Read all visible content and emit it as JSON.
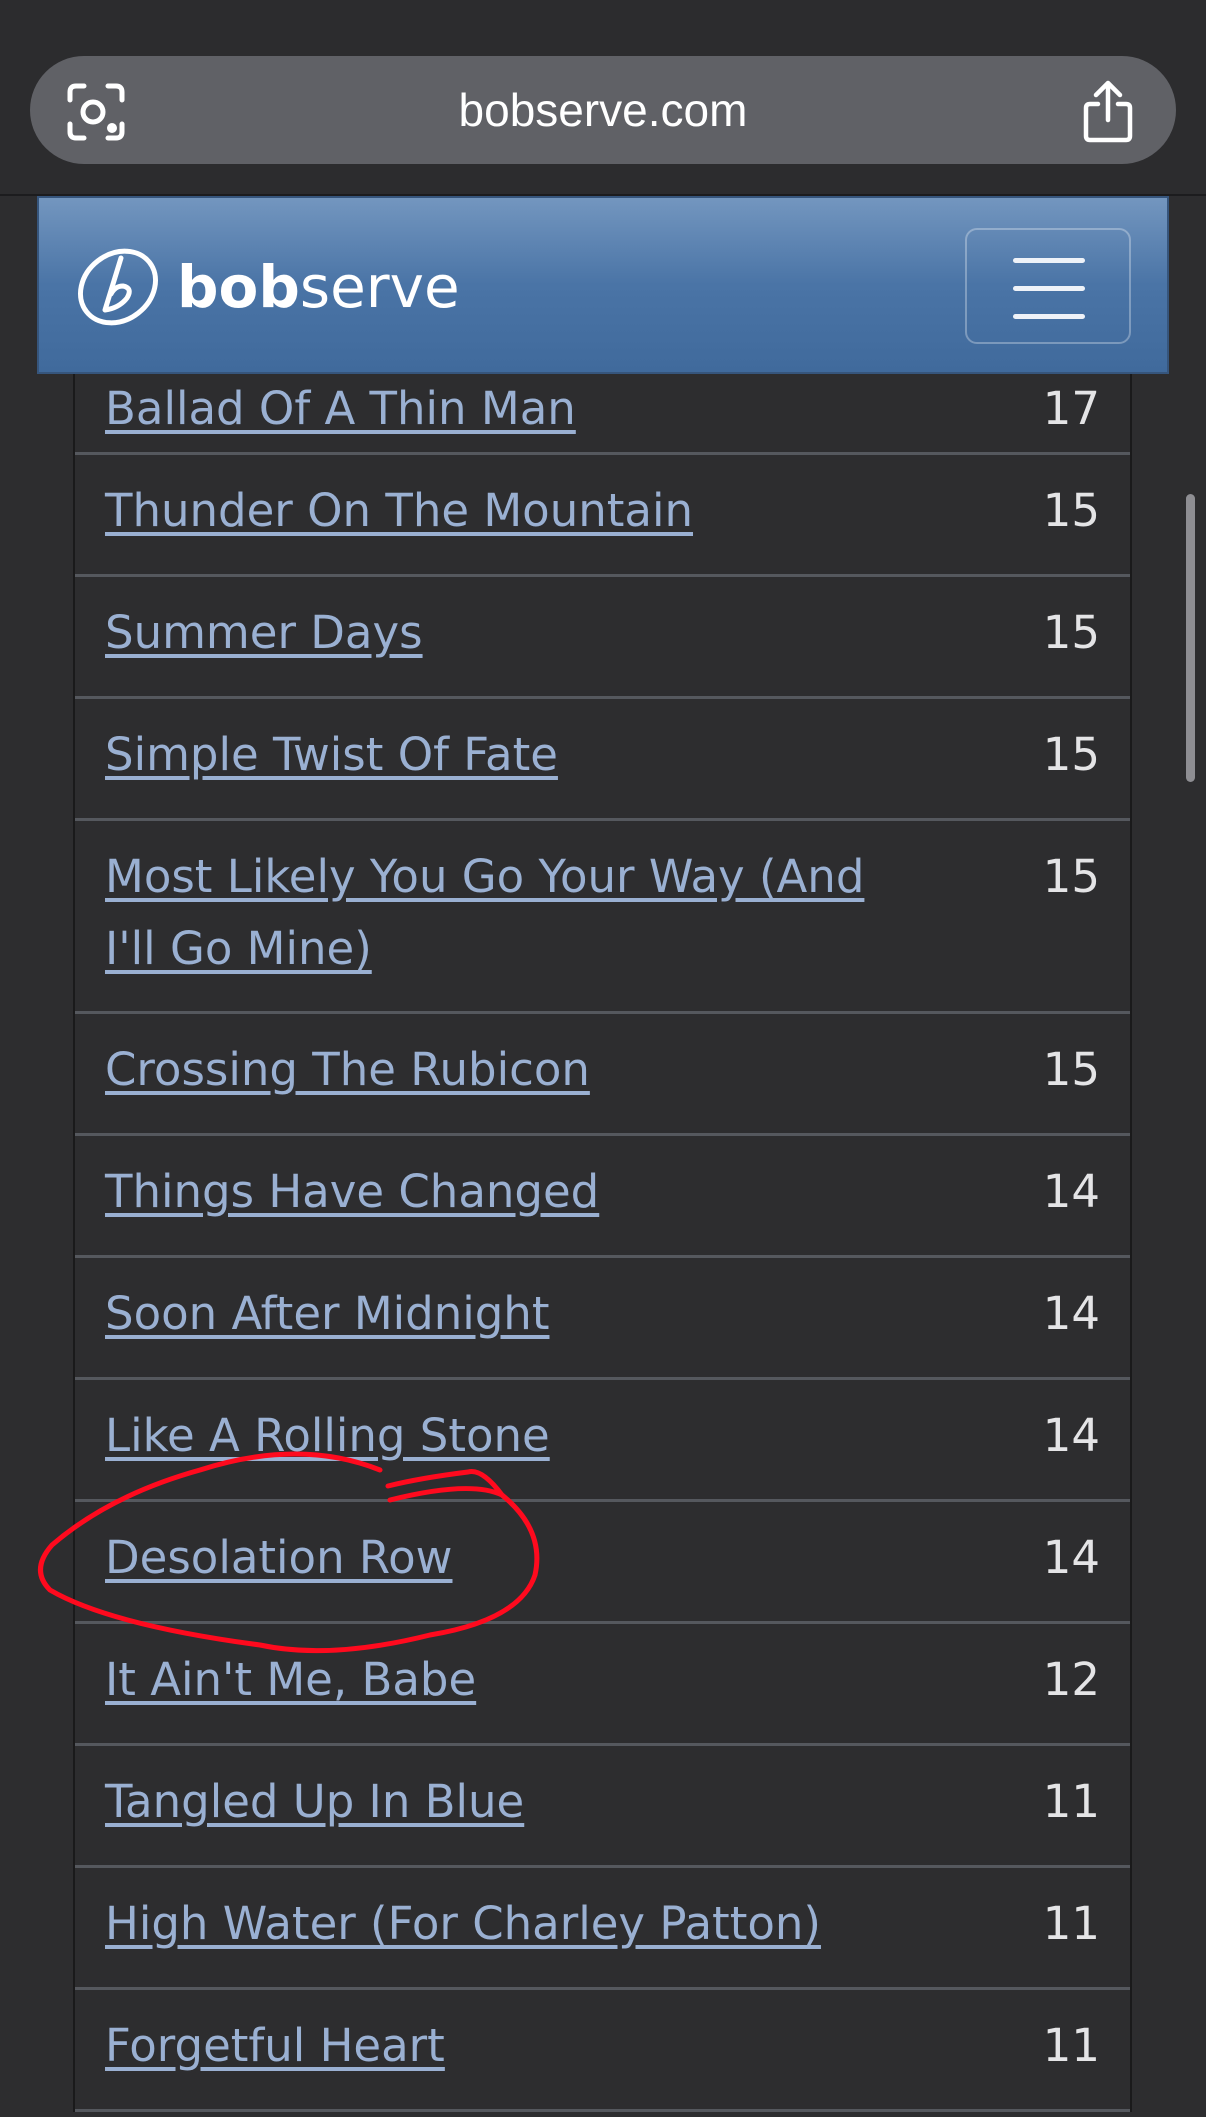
{
  "browser": {
    "url": "bobserve.com"
  },
  "navbar": {
    "brand_bold": "bob",
    "brand_regular": "serve"
  },
  "songs": [
    {
      "title": "Ballad Of A Thin Man",
      "count": "17"
    },
    {
      "title": "Thunder On The Mountain",
      "count": "15"
    },
    {
      "title": "Summer Days",
      "count": "15"
    },
    {
      "title": "Simple Twist Of Fate",
      "count": "15"
    },
    {
      "title": "Most Likely You Go Your Way (And I'll Go Mine)",
      "count": "15"
    },
    {
      "title": "Crossing The Rubicon",
      "count": "15"
    },
    {
      "title": "Things Have Changed",
      "count": "14"
    },
    {
      "title": "Soon After Midnight",
      "count": "14"
    },
    {
      "title": "Like A Rolling Stone",
      "count": "14"
    },
    {
      "title": "Desolation Row",
      "count": "14"
    },
    {
      "title": "It Ain't Me, Babe",
      "count": "12"
    },
    {
      "title": "Tangled Up In Blue",
      "count": "11"
    },
    {
      "title": "High Water (For Charley Patton)",
      "count": "11"
    },
    {
      "title": "Forgetful Heart",
      "count": "11"
    }
  ],
  "icons": {
    "reader": "reader-view-icon",
    "share": "share-icon",
    "logo": "bobserve-logo-icon",
    "menu": "hamburger-menu-icon"
  },
  "colors": {
    "page_background": "#2d2d2f",
    "link": "#9ab0d2",
    "navbar": "#4a74a6",
    "annotation": "#ff0a1e"
  },
  "annotation": {
    "circled_song": "Desolation Row"
  }
}
